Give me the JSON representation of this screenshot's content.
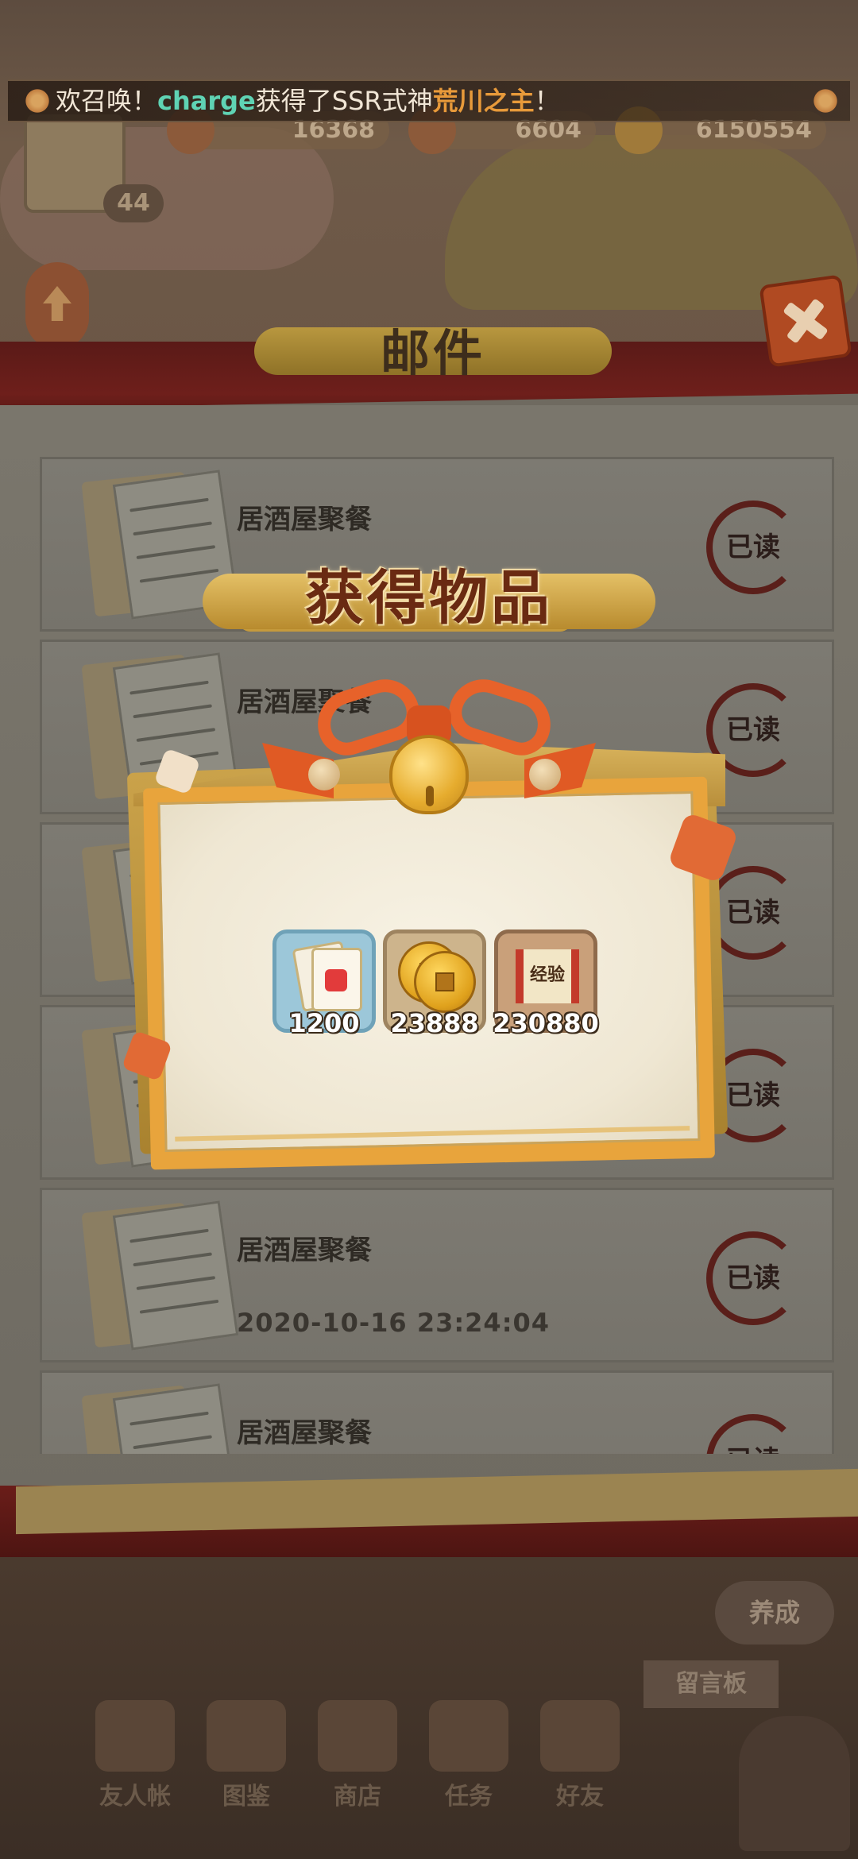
{
  "announcement": {
    "prefix": "欢召唤！",
    "player": "charge",
    "middle": "获得了SSR式神",
    "shikigami": "荒川之主",
    "suffix": "！"
  },
  "resources": {
    "level": "44",
    "res1": "16368",
    "res2": "6604",
    "coins": "6150554"
  },
  "mail_title": "邮件",
  "mails": [
    {
      "subject": "居酒屋聚餐",
      "date": "",
      "status": "已读"
    },
    {
      "subject": "居酒屋聚餐",
      "date": "",
      "status": "已读"
    },
    {
      "subject": "",
      "date": "",
      "status": "已读"
    },
    {
      "subject": "",
      "date": "",
      "status": "已读"
    },
    {
      "subject": "居酒屋聚餐",
      "date": "2020-10-16 23:24:04",
      "status": "已读"
    },
    {
      "subject": "居酒屋聚餐",
      "date": "",
      "status": "已读"
    }
  ],
  "reward_popup": {
    "title": "获得物品",
    "items": [
      {
        "icon": "like-card-icon",
        "qty": "1200"
      },
      {
        "icon": "gold-coin-icon",
        "qty": "23888"
      },
      {
        "icon": "exp-scroll-icon",
        "qty": "230880",
        "label": "经验"
      }
    ]
  },
  "side_buttons": {
    "yangcheng": "养成",
    "liuyan": "留言板"
  },
  "bottom_nav": [
    {
      "label": "友人帐"
    },
    {
      "label": "图鉴"
    },
    {
      "label": "商店"
    },
    {
      "label": "任务"
    },
    {
      "label": "好友"
    }
  ],
  "colors": {
    "player_name": "#5fd3b4",
    "ssr_name": "#e89a3a",
    "ribbon": "#e7622a",
    "card_border": "#e8a43c"
  }
}
